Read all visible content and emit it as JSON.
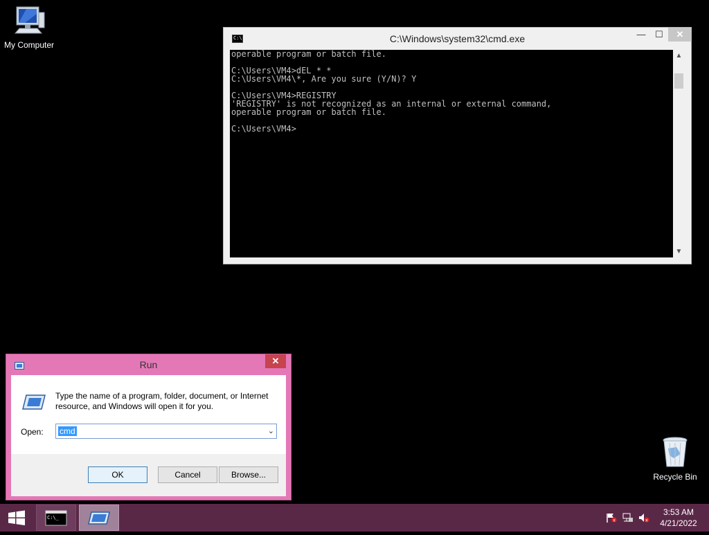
{
  "desktop": {
    "icons": [
      {
        "label": "My Computer",
        "icon": "computer-icon"
      },
      {
        "label": "Recycle Bin",
        "icon": "recycle-bin-icon"
      }
    ]
  },
  "cmd_window": {
    "title": "C:\\Windows\\system32\\cmd.exe",
    "icon_text": "C:\\",
    "minimize": "—",
    "maximize": "☐",
    "close": "✕",
    "console_text": "operable program or batch file.\n\nC:\\Users\\VM4>dEL * *\nC:\\Users\\VM4\\*, Are you sure (Y/N)? Y\n\nC:\\Users\\VM4>REGISTRY\n'REGISTRY' is not recognized as an internal or external command,\noperable program or batch file.\n\nC:\\Users\\VM4>"
  },
  "run_dialog": {
    "title": "Run",
    "close": "✕",
    "description": "Type the name of a program, folder, document, or Internet resource, and Windows will open it for you.",
    "open_label": "Open:",
    "input_value": "cmd",
    "buttons": {
      "ok": "OK",
      "cancel": "Cancel",
      "browse": "Browse..."
    }
  },
  "taskbar": {
    "tasks": [
      {
        "name": "cmd.exe",
        "icon": "cmd-icon"
      },
      {
        "name": "Run",
        "icon": "run-icon"
      }
    ],
    "tray_icons": [
      "action-center-flag-icon",
      "network-icon",
      "volume-muted-icon"
    ],
    "clock": {
      "time": "3:53 AM",
      "date": "4/21/2022"
    }
  },
  "colors": {
    "taskbar": "#5a2847",
    "run_dialog_frame": "#e478b7",
    "close_button": "#c7434d",
    "selection": "#3399ff"
  }
}
